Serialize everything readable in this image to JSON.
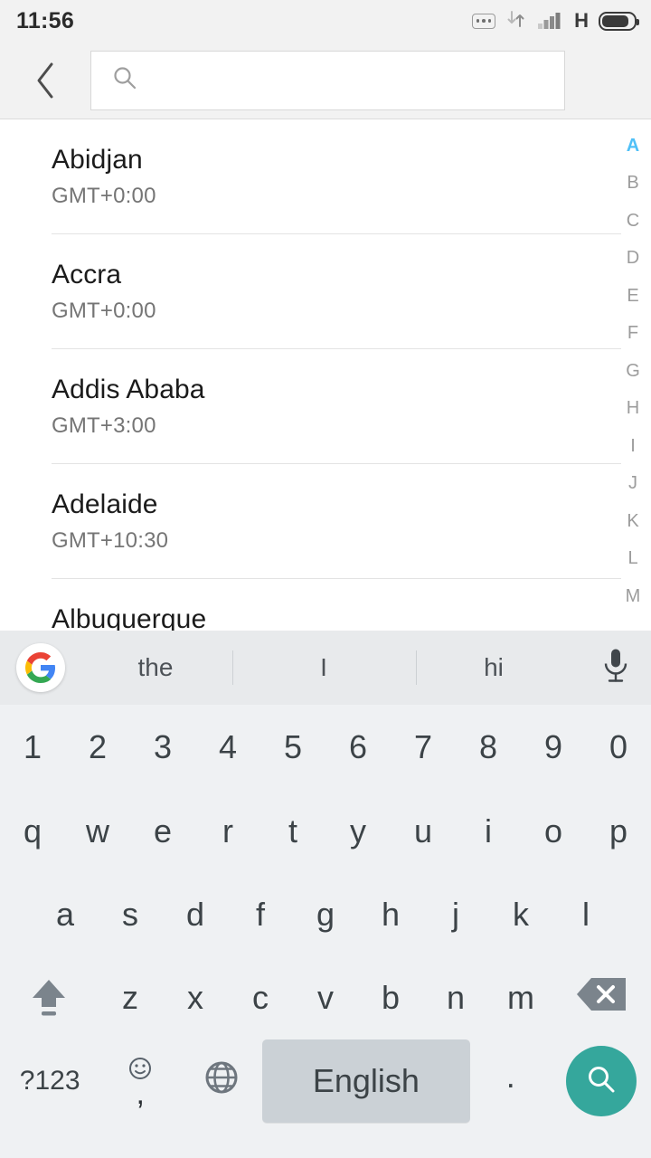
{
  "status_bar": {
    "time": "11:56",
    "icons": [
      "more-dots-icon",
      "data-transfer-icon",
      "signal-bars-icon",
      "network-type-label",
      "battery-icon"
    ],
    "network_type": "H"
  },
  "header": {
    "back_label": "chevron-left-icon",
    "search_value": "",
    "search_placeholder": ""
  },
  "city_list": [
    {
      "name": "Abidjan",
      "gmt": "GMT+0:00"
    },
    {
      "name": "Accra",
      "gmt": "GMT+0:00"
    },
    {
      "name": "Addis Ababa",
      "gmt": "GMT+3:00"
    },
    {
      "name": "Adelaide",
      "gmt": "GMT+10:30"
    },
    {
      "name": "Albuquerque",
      "gmt": ""
    }
  ],
  "alpha_index": {
    "active": "A",
    "letters": [
      "A",
      "B",
      "C",
      "D",
      "E",
      "F",
      "G",
      "H",
      "I",
      "J",
      "K",
      "L",
      "M"
    ]
  },
  "keyboard": {
    "suggestions": [
      "the",
      "I",
      "hi"
    ],
    "logo": "google-g-logo",
    "mic": "microphone-icon",
    "rows": {
      "numbers": [
        "1",
        "2",
        "3",
        "4",
        "5",
        "6",
        "7",
        "8",
        "9",
        "0"
      ],
      "top": [
        "q",
        "w",
        "e",
        "r",
        "t",
        "y",
        "u",
        "i",
        "o",
        "p"
      ],
      "home": [
        "a",
        "s",
        "d",
        "f",
        "g",
        "h",
        "j",
        "k",
        "l"
      ],
      "bottom": [
        "z",
        "x",
        "c",
        "v",
        "b",
        "n",
        "m"
      ]
    },
    "shift": "shift-icon",
    "backspace": "backspace-icon",
    "symbols_label": "?123",
    "comma_label": ",",
    "emoji": "emoji-smiley-icon",
    "globe": "globe-language-icon",
    "space_label": "English",
    "period_label": ".",
    "enter_action": "search-icon"
  },
  "colors": {
    "accent_index": "#4fc0f7",
    "enter_key": "#35a79c",
    "keyboard_bg": "#eff1f3",
    "suggestion_bg": "#e8eaec",
    "spacebar": "#cbd1d6",
    "header_bg": "#f2f2f2"
  }
}
